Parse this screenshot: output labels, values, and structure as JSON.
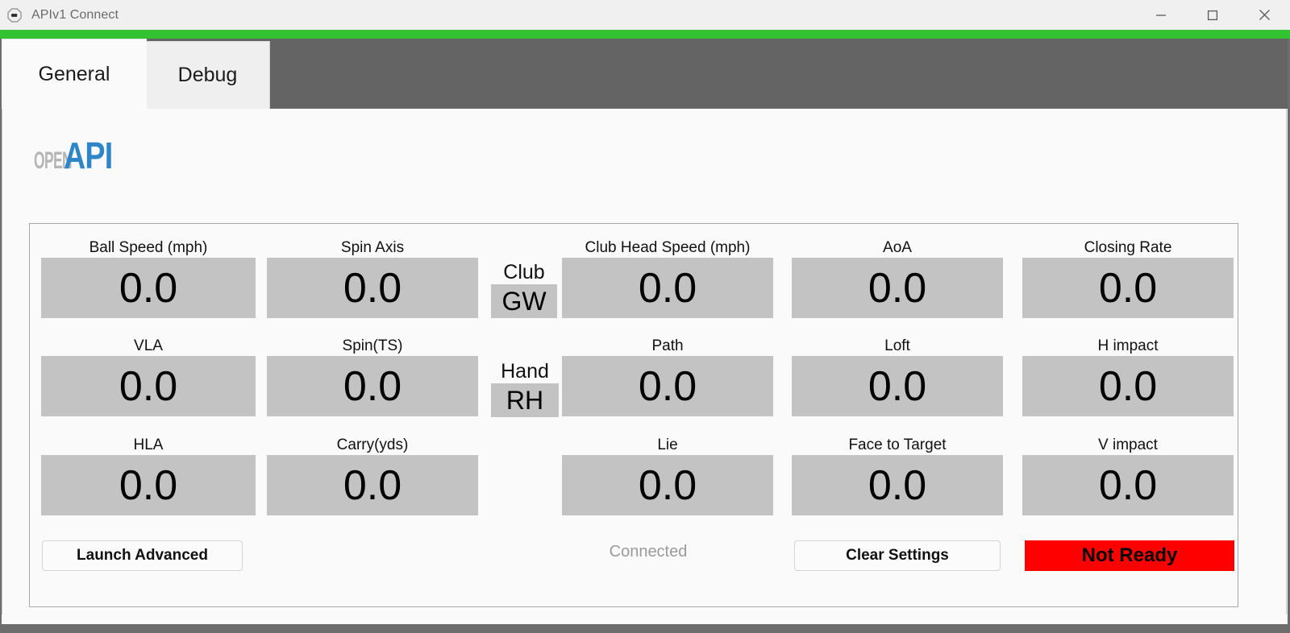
{
  "window": {
    "title": "APIv1 Connect",
    "icon": "app-octagon-icon",
    "minimize_label": "—",
    "maximize_label": "□",
    "close_label": "✕",
    "accent_green": "#32c232",
    "chrome_gray": "#6d6d6d"
  },
  "tabs": [
    {
      "label": "General",
      "active": true
    },
    {
      "label": "Debug",
      "active": false
    }
  ],
  "logo": {
    "prefix": "OPEN",
    "suffix": "API",
    "prefix_color": "#b5b5b5",
    "suffix_color": "#2e86c8"
  },
  "fields": {
    "ball_speed": {
      "label": "Ball Speed (mph)",
      "value": "0.0"
    },
    "vla": {
      "label": "VLA",
      "value": "0.0"
    },
    "hla": {
      "label": "HLA",
      "value": "0.0"
    },
    "spin_axis": {
      "label": "Spin Axis",
      "value": "0.0"
    },
    "spin_ts": {
      "label": "Spin(TS)",
      "value": "0.0"
    },
    "carry": {
      "label": "Carry(yds)",
      "value": "0.0"
    },
    "club": {
      "label": "Club",
      "value": "GW"
    },
    "hand": {
      "label": "Hand",
      "value": "RH"
    },
    "club_head_speed": {
      "label": "Club Head Speed (mph)",
      "value": "0.0"
    },
    "path": {
      "label": "Path",
      "value": "0.0"
    },
    "lie": {
      "label": "Lie",
      "value": "0.0"
    },
    "aoa": {
      "label": "AoA",
      "value": "0.0"
    },
    "loft": {
      "label": "Loft",
      "value": "0.0"
    },
    "face_to_target": {
      "label": "Face to Target",
      "value": "0.0"
    },
    "closing_rate": {
      "label": "Closing Rate",
      "value": "0.0"
    },
    "h_impact": {
      "label": "H impact",
      "value": "0.0"
    },
    "v_impact": {
      "label": "V impact",
      "value": "0.0"
    }
  },
  "footer": {
    "launch_advanced_label": "Launch Advanced",
    "connection_status": "Connected",
    "clear_settings_label": "Clear Settings",
    "ready_status_label": "Not Ready",
    "ready_status_color": "#ff0000"
  }
}
